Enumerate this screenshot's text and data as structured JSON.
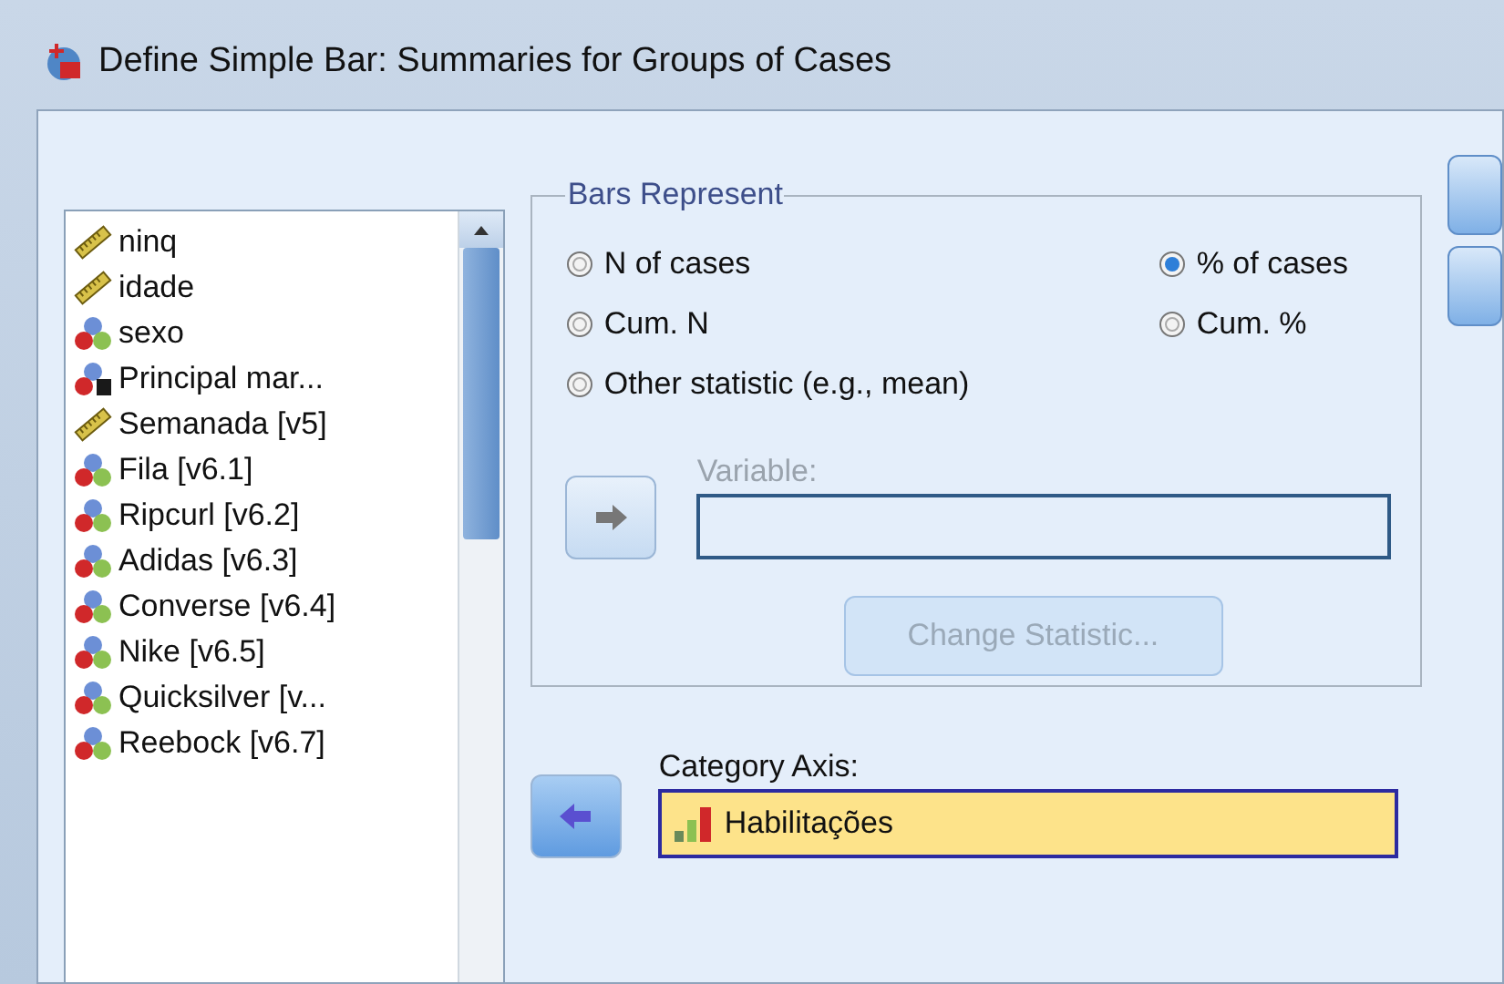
{
  "window": {
    "title": "Define Simple Bar: Summaries for Groups of Cases"
  },
  "variables": [
    {
      "name": "ninq",
      "kind": "scale"
    },
    {
      "name": "idade",
      "kind": "scale"
    },
    {
      "name": "sexo",
      "kind": "nominal"
    },
    {
      "name": "Principal mar...",
      "kind": "nominal-string"
    },
    {
      "name": "Semanada [v5]",
      "kind": "scale"
    },
    {
      "name": "Fila [v6.1]",
      "kind": "nominal"
    },
    {
      "name": "Ripcurl [v6.2]",
      "kind": "nominal"
    },
    {
      "name": "Adidas [v6.3]",
      "kind": "nominal"
    },
    {
      "name": "Converse [v6.4]",
      "kind": "nominal"
    },
    {
      "name": "Nike [v6.5]",
      "kind": "nominal"
    },
    {
      "name": "Quicksilver [v...",
      "kind": "nominal"
    },
    {
      "name": "Reebock [v6.7]",
      "kind": "nominal"
    }
  ],
  "bars_represent": {
    "title": "Bars Represent",
    "options": [
      {
        "label": "N of cases",
        "selected": false
      },
      {
        "label": "% of cases",
        "selected": true
      },
      {
        "label": "Cum. N",
        "selected": false
      },
      {
        "label": "Cum. %",
        "selected": false
      },
      {
        "label": "Other statistic (e.g., mean)",
        "selected": false
      }
    ],
    "variable": {
      "label": "Variable:",
      "disabled": true
    },
    "change_statistic": {
      "label": "Change Statistic...",
      "disabled": true
    }
  },
  "category_axis": {
    "label": "Category Axis:",
    "value": "Habilitações"
  }
}
